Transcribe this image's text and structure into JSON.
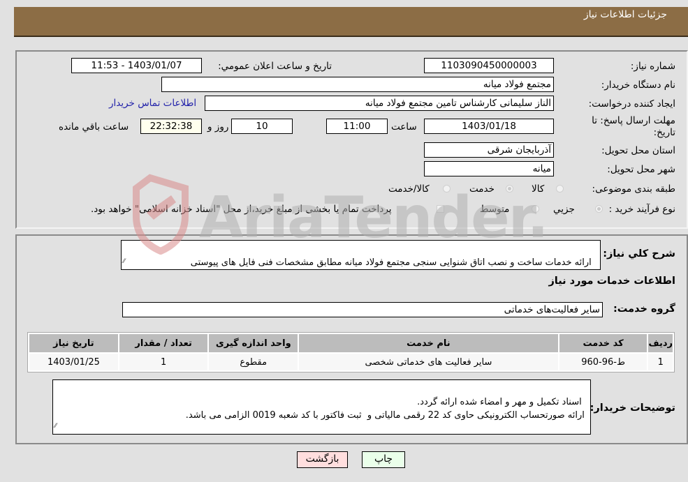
{
  "header": {
    "title": "جزئیات اطلاعات نیاز"
  },
  "form": {
    "need_number": {
      "label": "شماره نیاز:",
      "value": "1103090450000003"
    },
    "announce_datetime": {
      "label": "تاریخ و ساعت اعلان عمومي:",
      "value": "1403/01/07 - 11:53"
    },
    "buyer_org": {
      "label": "نام دستگاه خريدار:",
      "value": "مجتمع فولاد میانه"
    },
    "requester": {
      "label": "ايجاد كننده درخواست:",
      "value": "الناز سلیمانی کارشناس تامین مجتمع فولاد میانه"
    },
    "buyer_contact_link": "اطلاعات تماس خريدار",
    "deadline": {
      "label_line1": "مهلت ارسال پاسخ: تا",
      "label_line2": "تاريخ:",
      "date": "1403/01/18",
      "time_label": "ساعت",
      "time": "11:00",
      "days": "10",
      "days_label": "روز و",
      "remaining": "22:32:38",
      "remaining_label": "ساعت باقي مانده"
    },
    "delivery_province": {
      "label": "استان محل تحويل:",
      "value": "آذربایجان شرقی"
    },
    "delivery_city": {
      "label": "شهر محل تحويل:",
      "value": "میانه"
    },
    "category": {
      "label": "طبقه بندی موضوعی:",
      "options": [
        "كالا",
        "خدمت",
        "كالا/خدمت"
      ],
      "selected": "خدمت"
    },
    "purchase_process": {
      "label": "نوع فرآيند خريد :",
      "options": [
        "جزيي",
        "متوسط"
      ],
      "selected": "جزيي",
      "treasury_note": "پرداخت تمام يا بخشی از مبلغ خريد،از محل \"اسناد خزانه اسلامی\" خواهد بود.",
      "treasury_checked": false
    }
  },
  "description": {
    "label": "شرح كلي نياز:",
    "value": "ارائه خدمات ساخت و نصب اتاق شنوایی سنجی مجتمع فولاد میانه مطابق مشخصات فنی فایل های پیوستی"
  },
  "services": {
    "section_title": "اطلاعات خدمات مورد نياز",
    "group_label": "گروه خدمت:",
    "group_value": "سایر فعالیت‌های خدماتی",
    "table": {
      "headers": [
        "رديف",
        "كد خدمت",
        "نام خدمت",
        "واحد اندازه گيری",
        "تعداد / مقدار",
        "تاريخ نياز"
      ],
      "rows": [
        [
          "1",
          "ط-96-960",
          "سایر فعالیت های خدماتی شخصی",
          "مقطوع",
          "1",
          "1403/01/25"
        ]
      ]
    }
  },
  "buyer_notes": {
    "label": "توضيحات خريدار:",
    "value": "اسناد تکمیل و مهر و امضاء شده ارائه گردد.\n ارائه صورتحساب الکترونیکی حاوی کد 22 رقمی مالیاتی و  ثبت فاکتور با کد شعبه 0019 الزامی می باشد."
  },
  "buttons": {
    "print": "چاپ",
    "back": "بازگشت"
  },
  "watermark": {
    "text": "AriaTender.neT",
    "colors": {
      "logo": "#d98b8b",
      "text": "#b0b0b0"
    }
  },
  "colors": {
    "header_bg": "#8c6d45",
    "print_bg": "#eaffea",
    "back_bg": "#ffdede",
    "link": "#2222aa"
  }
}
